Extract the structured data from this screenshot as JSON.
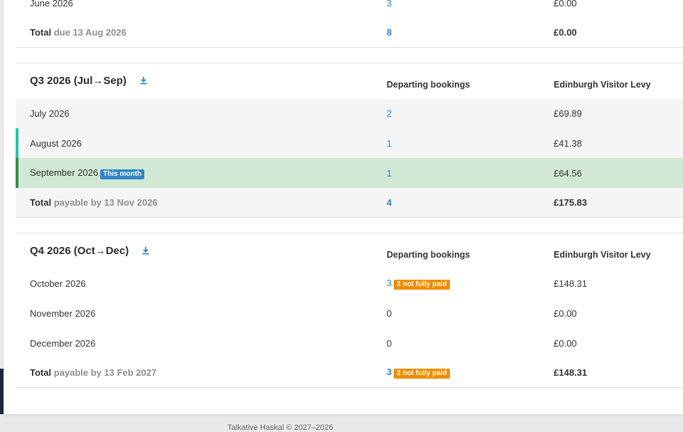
{
  "q2": {
    "rows": [
      {
        "month": "June 2026",
        "bookings": "3",
        "levy": "£0.00"
      }
    ],
    "total": {
      "label": "Total",
      "due": "due 13 Aug 2026",
      "bookings": "8",
      "levy": "£0.00"
    }
  },
  "q3": {
    "title": "Q3 2026 (Jul→Sep)",
    "col_bookings": "Departing bookings",
    "col_levy": "Edinburgh Visitor Levy",
    "rows": [
      {
        "month": "July 2026",
        "bookings": "2",
        "levy": "£69.89"
      },
      {
        "month": "August 2026",
        "bookings": "1",
        "levy": "£41.38"
      },
      {
        "month": "September 2026",
        "badge": "This month",
        "bookings": "1",
        "levy": "£64.56"
      }
    ],
    "total": {
      "label": "Total",
      "due": "payable by 13 Nov 2026",
      "bookings": "4",
      "levy": "£175.83"
    }
  },
  "q4": {
    "title": "Q4 2026 (Oct→Dec)",
    "col_bookings": "Departing bookings",
    "col_levy": "Edinburgh Visitor Levy",
    "rows": [
      {
        "month": "October 2026",
        "bookings": "3",
        "badge": "2 not fully paid",
        "levy": "£148.31"
      },
      {
        "month": "November 2026",
        "bookings": "0",
        "levy": "£0.00"
      },
      {
        "month": "December 2026",
        "bookings": "0",
        "levy": "£0.00"
      }
    ],
    "total": {
      "label": "Total",
      "due": "payable by 13 Feb 2027",
      "bookings": "3",
      "badge": "2 not fully paid",
      "levy": "£148.31"
    }
  },
  "footer": {
    "text": "Talkative Haskal © 2027–2026"
  },
  "colors": {
    "link": "#2a86d1",
    "current_month_bg": "#d1e8d4",
    "badge_orange": "#f08c00",
    "badge_blue": "#2f86c8",
    "accent_teal": "#2ac2a8",
    "accent_green": "#3a8a44"
  }
}
